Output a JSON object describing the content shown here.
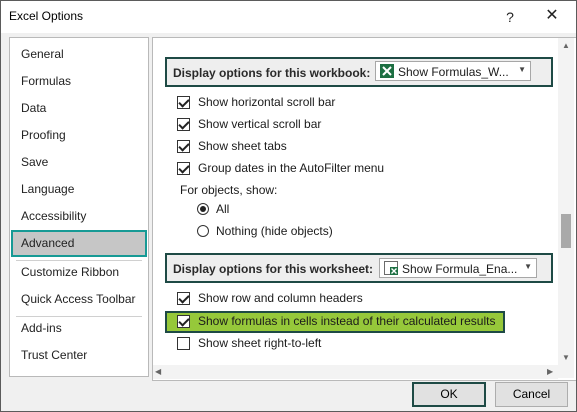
{
  "window": {
    "title": "Excel Options",
    "help_icon": "?",
    "close_icon": "✕"
  },
  "nav": {
    "items": [
      {
        "label": "General"
      },
      {
        "label": "Formulas"
      },
      {
        "label": "Data"
      },
      {
        "label": "Proofing"
      },
      {
        "label": "Save"
      },
      {
        "label": "Language"
      },
      {
        "label": "Accessibility"
      },
      {
        "label": "Advanced",
        "active": true
      },
      {
        "label": "Customize Ribbon"
      },
      {
        "label": "Quick Access Toolbar"
      },
      {
        "label": "Add-ins"
      },
      {
        "label": "Trust Center"
      }
    ]
  },
  "workbook_section": {
    "label": "Display options for this workbook:",
    "selected": "Show Formulas_W...",
    "options": [
      {
        "label": "Show horizontal scroll bar",
        "checked": true
      },
      {
        "label": "Show vertical scroll bar",
        "checked": true
      },
      {
        "label": "Show sheet tabs",
        "checked": true
      },
      {
        "label": "Group dates in the AutoFilter menu",
        "checked": true
      }
    ],
    "objects_label": "For objects, show:",
    "radio_all": "All",
    "radio_nothing": "Nothing (hide objects)"
  },
  "worksheet_section": {
    "label": "Display options for this worksheet:",
    "selected": "Show Formula_Ena...",
    "options": [
      {
        "label": "Show row and column headers",
        "checked": true
      },
      {
        "label": "Show formulas in cells instead of their calculated results",
        "checked": true,
        "highlighted": true
      },
      {
        "label": "Show sheet right-to-left",
        "checked": false
      }
    ]
  },
  "buttons": {
    "ok": "OK",
    "cancel": "Cancel"
  },
  "colors": {
    "accent": "#179a95",
    "highlight": "#96c83a",
    "border": "#1e4a45",
    "excel_green": "#1d6f42"
  }
}
